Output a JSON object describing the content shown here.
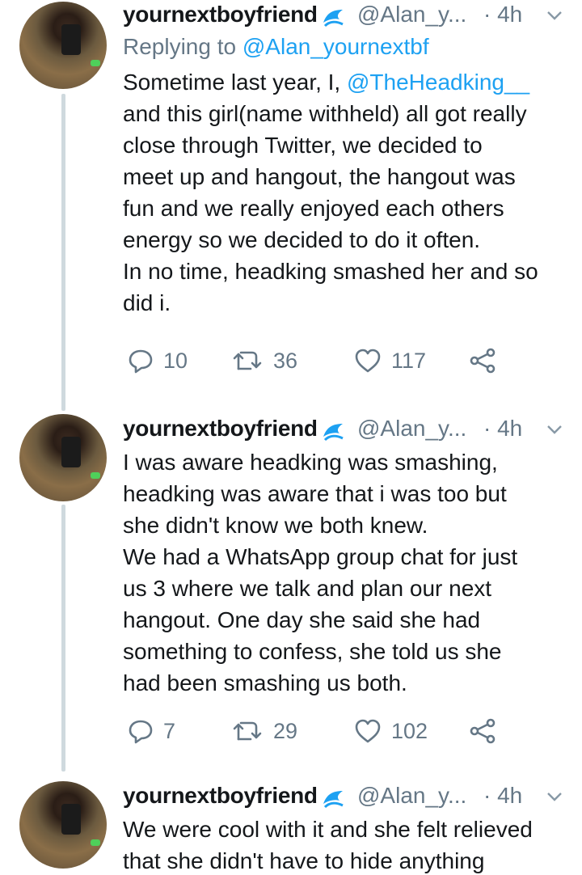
{
  "tweets": [
    {
      "name": "yournextboyfriend",
      "handle": "@Alan_y...",
      "time": "· 4h",
      "replying_prefix": "Replying to ",
      "replying_to": "@Alan_yournextbf",
      "body_pre": "Sometime last year, I, ",
      "body_mention": "@TheHeadking__",
      "body_post": "\nand this girl(name withheld) all got really\nclose through Twitter, we decided to\nmeet up and hangout, the hangout was\nfun and we really enjoyed each others\nenergy so we decided to do it often.\nIn no time, headking smashed her and so\ndid i.",
      "replies": "10",
      "retweets": "36",
      "likes": "117"
    },
    {
      "name": "yournextboyfriend",
      "handle": "@Alan_y...",
      "time": "· 4h",
      "body": "I was aware headking was smashing,\nheadking was aware that i was too but\nshe didn't know we both knew.\nWe had a WhatsApp group chat for just\nus 3 where we talk and plan our next\nhangout. One day she said she had\nsomething to confess, she told us she\nhad been smashing us both.",
      "replies": "7",
      "retweets": "29",
      "likes": "102"
    },
    {
      "name": "yournextboyfriend",
      "handle": "@Alan_y...",
      "time": "· 4h",
      "body": "We were cool with it and she felt relieved\nthat she didn't have to hide anything"
    }
  ],
  "icons": {
    "verified": "verified-badge-icon",
    "reply": "reply-icon",
    "retweet": "retweet-icon",
    "like": "heart-icon",
    "share": "share-icon",
    "more": "chevron-down-icon"
  },
  "colors": {
    "text": "#14171a",
    "muted": "#657786",
    "link": "#1da1f2",
    "thread_line": "#cfd9de"
  }
}
